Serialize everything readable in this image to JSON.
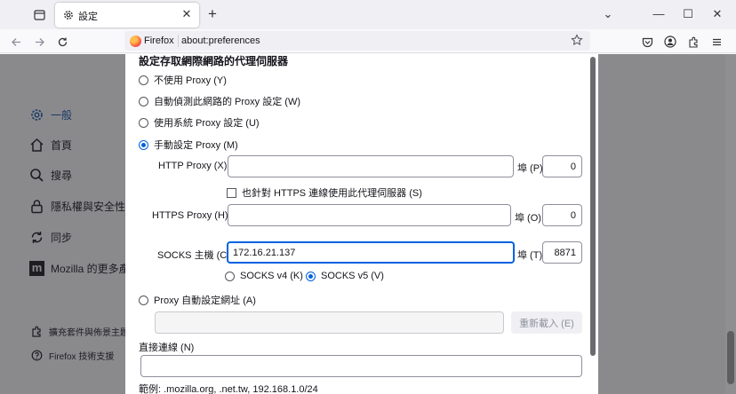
{
  "tab": {
    "title": "設定"
  },
  "urlbar": {
    "identity": "Firefox",
    "url": "about:preferences"
  },
  "sidebar": {
    "items": [
      {
        "label": "一般",
        "icon": "gear-icon"
      },
      {
        "label": "首頁",
        "icon": "home-icon"
      },
      {
        "label": "搜尋",
        "icon": "search-icon"
      },
      {
        "label": "隱私權與安全性",
        "icon": "lock-icon"
      },
      {
        "label": "同步",
        "icon": "sync-icon"
      },
      {
        "label": "Mozilla 的更多產",
        "icon": "mozilla-icon"
      }
    ],
    "footer": [
      {
        "label": "擴充套件與佈景主題",
        "icon": "puzzle-icon"
      },
      {
        "label": "Firefox 技術支援",
        "icon": "help-icon"
      }
    ]
  },
  "dialog": {
    "title": "設定存取網際網路的代理伺服器",
    "options": {
      "no_proxy": "不使用 Proxy (Y)",
      "auto_detect": "自動偵測此網路的 Proxy 設定 (W)",
      "system": "使用系統 Proxy 設定 (U)",
      "manual": "手動設定 Proxy (M)",
      "pac": "Proxy 自動設定網址 (A)"
    },
    "http": {
      "label": "HTTP Proxy (X)",
      "value": "",
      "port_label": "埠 (P)",
      "port": "0"
    },
    "also_https": "也針對 HTTPS 連線使用此代理伺服器 (S)",
    "https": {
      "label": "HTTPS Proxy (H)",
      "value": "",
      "port_label": "埠 (O)",
      "port": "0"
    },
    "socks": {
      "label": "SOCKS 主機 (C)",
      "value": "172.16.21.137",
      "port_label": "埠 (T)",
      "port": "8871"
    },
    "socks_v4": "SOCKS v4 (K)",
    "socks_v5": "SOCKS v5 (V)",
    "reload_button": "重新載入 (E)",
    "no_proxy_for": "直接連線 (N)",
    "example": "範例: .mozilla.org, .net.tw, 192.168.1.0/24"
  },
  "colors": {
    "accent": "#0061e0",
    "overlay": "#8a8a8d"
  }
}
